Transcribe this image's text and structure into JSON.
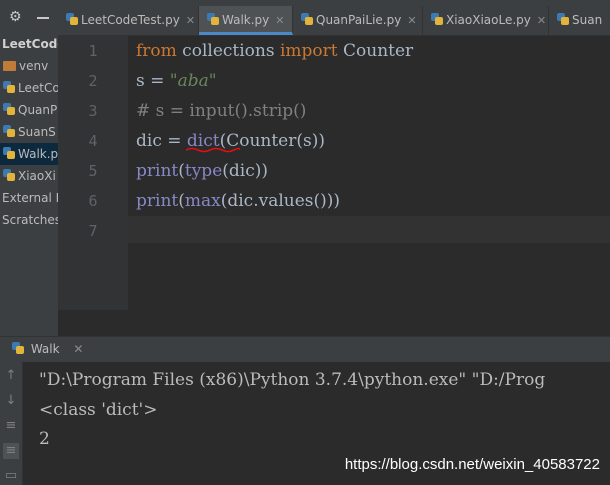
{
  "sidebar": {
    "gear_icon": "gear-icon",
    "items": [
      {
        "label": "LeetCode",
        "icon": "none",
        "style": "bold"
      },
      {
        "label": "venv",
        "icon": "folder-icon",
        "style": "normal"
      },
      {
        "label": "LeetCo",
        "icon": "python-file-icon",
        "style": "normal"
      },
      {
        "label": "QuanP",
        "icon": "python-file-icon",
        "style": "normal"
      },
      {
        "label": "SuanS",
        "icon": "python-file-icon",
        "style": "normal"
      },
      {
        "label": "Walk.p",
        "icon": "python-file-icon",
        "style": "selected"
      },
      {
        "label": "XiaoXi",
        "icon": "python-file-icon",
        "style": "normal"
      },
      {
        "label": "External L",
        "icon": "none",
        "style": "normal"
      },
      {
        "label": "Scratches",
        "icon": "none",
        "style": "normal"
      }
    ]
  },
  "tabs": [
    {
      "label": "LeetCodeTest.py",
      "active": false
    },
    {
      "label": "Walk.py",
      "active": true
    },
    {
      "label": "QuanPaiLie.py",
      "active": false
    },
    {
      "label": "XiaoXiaoLe.py",
      "active": false
    },
    {
      "label": "Suan",
      "active": false
    }
  ],
  "editor": {
    "line_numbers": [
      "1",
      "2",
      "3",
      "4",
      "5",
      "6",
      "7"
    ],
    "lines": [
      [
        {
          "t": "from",
          "c": "kw"
        },
        {
          "t": " collections ",
          "c": ""
        },
        {
          "t": "import",
          "c": "kw"
        },
        {
          "t": " Counter",
          "c": ""
        }
      ],
      [
        {
          "t": "s = ",
          "c": ""
        },
        {
          "t": "\"aba\"",
          "c": "str"
        }
      ],
      [
        {
          "t": "# s = input().strip()",
          "c": "cmt"
        }
      ],
      [
        {
          "t": "dic = ",
          "c": ""
        },
        {
          "t": "dict",
          "c": "bi"
        },
        {
          "t": "(Counter(s))",
          "c": ""
        }
      ],
      [
        {
          "t": "print",
          "c": "bi"
        },
        {
          "t": "(",
          "c": ""
        },
        {
          "t": "type",
          "c": "bi"
        },
        {
          "t": "(dic))",
          "c": ""
        }
      ],
      [
        {
          "t": "print",
          "c": "bi"
        },
        {
          "t": "(",
          "c": ""
        },
        {
          "t": "max",
          "c": "bi"
        },
        {
          "t": "(dic.values()))",
          "c": ""
        }
      ],
      []
    ]
  },
  "run": {
    "tab_label": "Walk",
    "output": [
      "\"D:\\Program Files (x86)\\Python 3.7.4\\python.exe\" \"D:/Prog",
      "<class 'dict'>",
      "2"
    ]
  },
  "watermark": "https://blog.csdn.net/weixin_40583722",
  "colors": {
    "keyword": "#cc7832",
    "string": "#6a8759",
    "comment": "#808080",
    "builtin": "#8888c6",
    "squiggle": "#e01010",
    "active_tab_underline": "#4a88c7"
  }
}
